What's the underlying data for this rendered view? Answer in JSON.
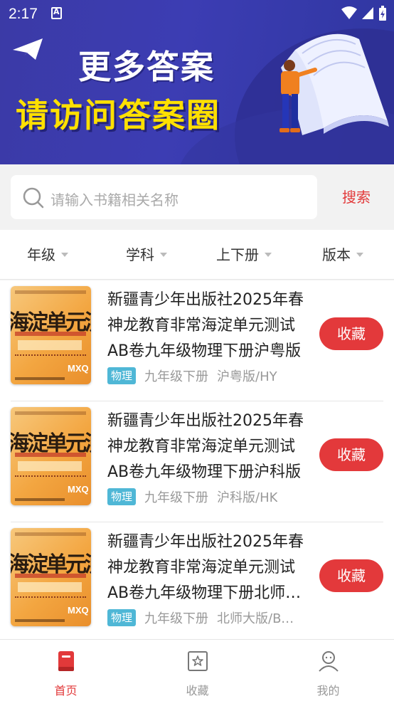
{
  "status_bar": {
    "time": "2:17"
  },
  "banner": {
    "line1": "更多答案",
    "line2": "请访问答案圈"
  },
  "search": {
    "placeholder": "请输入书籍相关名称",
    "button": "搜索"
  },
  "filters": [
    {
      "label": "年级"
    },
    {
      "label": "学科"
    },
    {
      "label": "上下册"
    },
    {
      "label": "版本"
    }
  ],
  "books": [
    {
      "title": "新疆青少年出版社2025年春神龙教育非常海淀单元测试AB卷九年级物理下册沪粤版",
      "subject": "物理",
      "grade": "九年级下册",
      "edition": "沪粤版/HY",
      "button": "收藏",
      "cover": {
        "title": "海淀单元测试AB",
        "mark": "MXQ"
      }
    },
    {
      "title": "新疆青少年出版社2025年春神龙教育非常海淀单元测试AB卷九年级物理下册沪科版",
      "subject": "物理",
      "grade": "九年级下册",
      "edition": "沪科版/HK",
      "button": "收藏",
      "cover": {
        "title": "海淀单元测试AB",
        "mark": "MXQ"
      }
    },
    {
      "title": "新疆青少年出版社2025年春神龙教育非常海淀单元测试AB卷九年级物理下册北师大版",
      "subject": "物理",
      "grade": "九年级下册",
      "edition": "北师大版/BS...",
      "button": "收藏",
      "cover": {
        "title": "海淀单元测试AB",
        "mark": "MXQ"
      }
    }
  ],
  "nav": {
    "home": {
      "label": "首页",
      "icon": "book-icon"
    },
    "favorites": {
      "label": "收藏",
      "icon": "star-box-icon"
    },
    "mine": {
      "label": "我的",
      "icon": "person-icon"
    }
  },
  "colors": {
    "accent": "#e3393b",
    "banner": "#3b3aa6",
    "tag": "#4fb7d6",
    "highlight": "#ffe000"
  }
}
